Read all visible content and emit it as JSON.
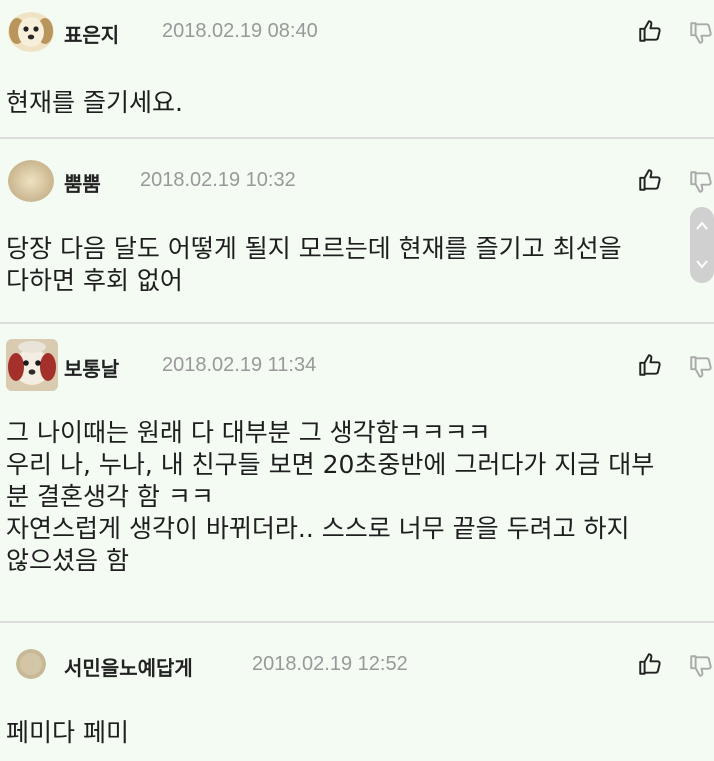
{
  "comments": [
    {
      "nickname": "표은지",
      "date": "2018.02.19 08:40",
      "avatar": "puppy-avatar",
      "lines": [
        "현재를 즐기세요."
      ]
    },
    {
      "nickname": "뿜뿜",
      "date": "2018.02.19 10:32",
      "avatar": "blurred-avatar",
      "lines": [
        "당장 다음 달도 어떻게 될지 모르는데 현재를 즐기고 최선을",
        "다하면 후회 없어"
      ]
    },
    {
      "nickname": "보통날",
      "date": "2018.02.19 11:34",
      "avatar": "dog-avatar",
      "lines": [
        "그 나이때는 원래 다 대부분 그 생각함ㅋㅋㅋㅋ",
        "우리 나, 누나, 내 친구들 보면 20초중반에 그러다가 지금 대부",
        "분 결혼생각 함 ㅋㅋ",
        "자연스럽게 생각이 바뀌더라.. 스스로 너무 끝을 두려고 하지",
        "않으셨음 함"
      ]
    },
    {
      "nickname": "서민을노예답게",
      "date": "2018.02.19 12:52",
      "avatar": "default-avatar",
      "lines": [
        "페미다 페미"
      ]
    }
  ],
  "icons": {
    "like": "thumbs-up-icon",
    "dislike": "thumbs-down-icon",
    "scroll": "scroll-handle"
  },
  "colors": {
    "background": "#f3fbf3",
    "divider": "#dcdcdc",
    "date": "#999999",
    "text": "#1e1e1e"
  }
}
